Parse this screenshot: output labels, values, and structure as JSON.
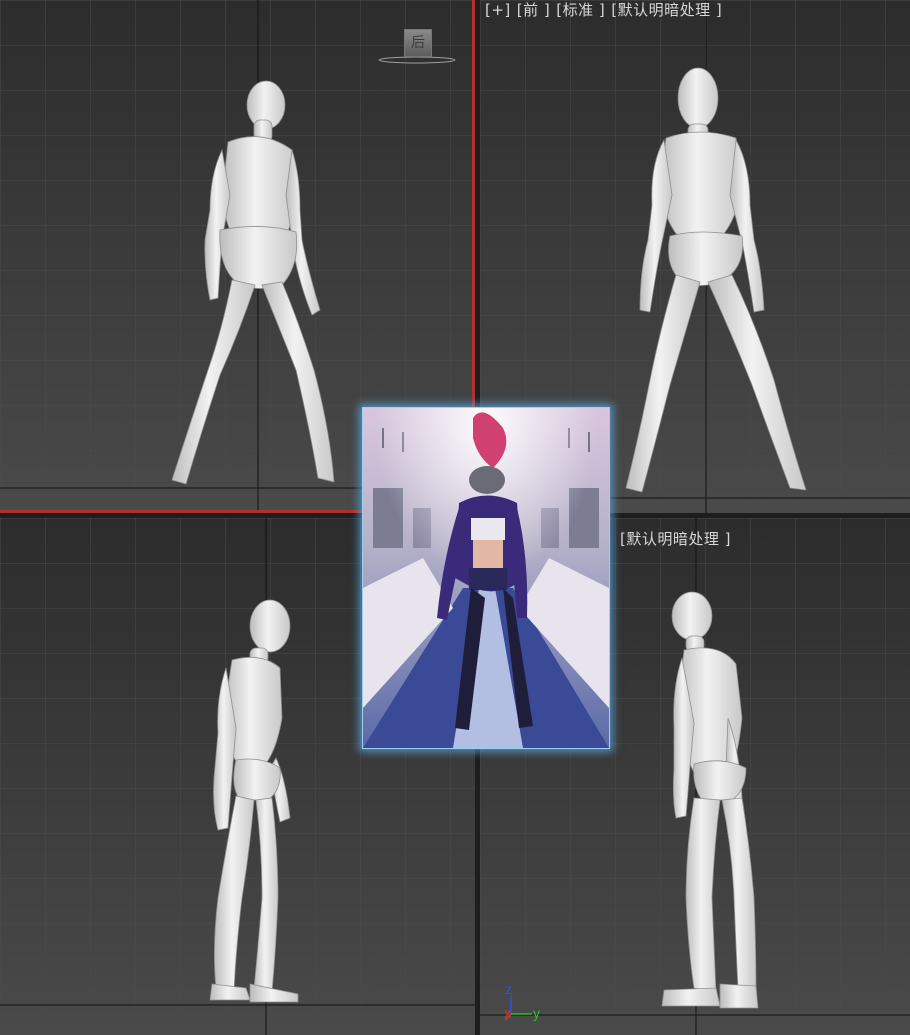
{
  "viewports": {
    "top_left": {
      "viewcube_face": "后"
    },
    "top_right": {
      "label_items": [
        "[+]",
        "[前 ]",
        "[标准 ]",
        "[默认明暗处理 ]"
      ]
    },
    "bottom_right": {
      "label_items": [
        "[默认明暗处理 ]"
      ]
    }
  },
  "axis_gizmo": {
    "z": "z",
    "x": "x",
    "y": "y"
  },
  "reference_image": {
    "subject": "anime-girl-in-subway-car"
  },
  "colors": {
    "viewport_bg": "#3a3a3a",
    "grid_line": "#4a4a4a",
    "active_border": "#b03030",
    "glow": "#5aaae6",
    "axis_x": "#e03030",
    "axis_y": "#30c030",
    "axis_z": "#3050e0"
  }
}
